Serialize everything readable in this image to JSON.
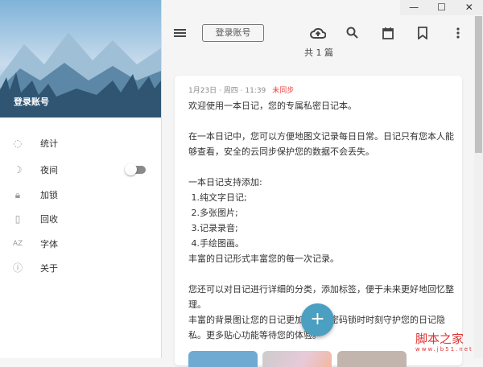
{
  "window": {
    "minimize": "—",
    "maximize": "☐",
    "close": "✕"
  },
  "sidebar": {
    "account": "登录账号",
    "items": [
      {
        "label": "统计",
        "icon": "stats-icon"
      },
      {
        "label": "夜间",
        "icon": "moon-icon",
        "toggle": false
      },
      {
        "label": "加锁",
        "icon": "lock-icon"
      },
      {
        "label": "回收",
        "icon": "trash-icon"
      },
      {
        "label": "字体",
        "icon": "font-icon"
      },
      {
        "label": "关于",
        "icon": "info-icon"
      }
    ]
  },
  "toolbar": {
    "login_label": "登录账号",
    "count": "共 1 篇"
  },
  "entry": {
    "date": "1月23日 · 周四 · 11:39",
    "status": "未同步",
    "status_color": "#e44444",
    "body": "欢迎使用一本日记，您的专属私密日记本。\n\n在一本日记中，您可以方便地图文记录每日日常。日记只有您本人能够查看，安全的云同步保护您的数据不会丢失。\n\n一本日记支持添加:\n 1.纯文字日记;\n 2.多张图片;\n 3.记录录音;\n 4.手绘图画。\n丰富的日记形式丰富您的每一次记录。\n\n您还可以对日记进行详细的分类，添加标签，便于未来更好地回忆整理。\n丰富的背景图让您的日记更加多彩，密码锁时时刻守护您的日记隐私。更多贴心功能等待您的体验。"
  },
  "fab": "+",
  "watermark": {
    "title": "脚本之家",
    "url": "www.jb51.net"
  }
}
